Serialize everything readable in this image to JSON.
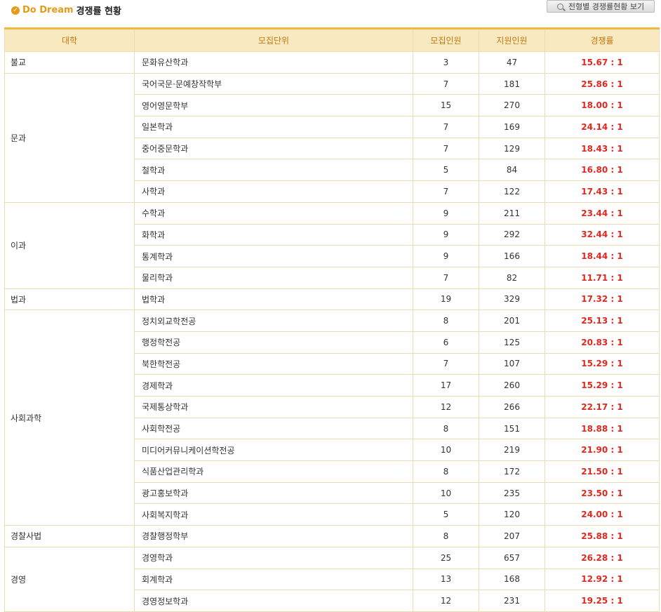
{
  "header": {
    "brand": "Do Dream",
    "title": "경쟁률 현황",
    "view_button": "전형별 경쟁률현황 보기"
  },
  "columns": [
    "대학",
    "모집단위",
    "모집인원",
    "지원인원",
    "경쟁률"
  ],
  "colors": {
    "accent": "#e69a17",
    "header_bg": "#f9e9c0",
    "rate": "#e0281e"
  },
  "groups": [
    {
      "college": "불교",
      "rows": [
        {
          "unit": "문화유산학과",
          "quota": "3",
          "applicants": "47",
          "rate": "15.67 : 1"
        }
      ]
    },
    {
      "college": "문과",
      "rows": [
        {
          "unit": "국어국문·문예창작학부",
          "quota": "7",
          "applicants": "181",
          "rate": "25.86 : 1"
        },
        {
          "unit": "영어영문학부",
          "quota": "15",
          "applicants": "270",
          "rate": "18.00 : 1"
        },
        {
          "unit": "일본학과",
          "quota": "7",
          "applicants": "169",
          "rate": "24.14 : 1"
        },
        {
          "unit": "중어중문학과",
          "quota": "7",
          "applicants": "129",
          "rate": "18.43 : 1"
        },
        {
          "unit": "철학과",
          "quota": "5",
          "applicants": "84",
          "rate": "16.80 : 1"
        },
        {
          "unit": "사학과",
          "quota": "7",
          "applicants": "122",
          "rate": "17.43 : 1"
        }
      ]
    },
    {
      "college": "이과",
      "rows": [
        {
          "unit": "수학과",
          "quota": "9",
          "applicants": "211",
          "rate": "23.44 : 1"
        },
        {
          "unit": "화학과",
          "quota": "9",
          "applicants": "292",
          "rate": "32.44 : 1"
        },
        {
          "unit": "통계학과",
          "quota": "9",
          "applicants": "166",
          "rate": "18.44 : 1"
        },
        {
          "unit": "물리학과",
          "quota": "7",
          "applicants": "82",
          "rate": "11.71 : 1"
        }
      ]
    },
    {
      "college": "법과",
      "rows": [
        {
          "unit": "법학과",
          "quota": "19",
          "applicants": "329",
          "rate": "17.32 : 1"
        }
      ]
    },
    {
      "college": "사회과학",
      "rows": [
        {
          "unit": "정치외교학전공",
          "quota": "8",
          "applicants": "201",
          "rate": "25.13 : 1"
        },
        {
          "unit": "행정학전공",
          "quota": "6",
          "applicants": "125",
          "rate": "20.83 : 1"
        },
        {
          "unit": "북한학전공",
          "quota": "7",
          "applicants": "107",
          "rate": "15.29 : 1"
        },
        {
          "unit": "경제학과",
          "quota": "17",
          "applicants": "260",
          "rate": "15.29 : 1"
        },
        {
          "unit": "국제통상학과",
          "quota": "12",
          "applicants": "266",
          "rate": "22.17 : 1"
        },
        {
          "unit": "사회학전공",
          "quota": "8",
          "applicants": "151",
          "rate": "18.88 : 1"
        },
        {
          "unit": "미디어커뮤니케이션학전공",
          "quota": "10",
          "applicants": "219",
          "rate": "21.90 : 1"
        },
        {
          "unit": "식품산업관리학과",
          "quota": "8",
          "applicants": "172",
          "rate": "21.50 : 1"
        },
        {
          "unit": "광고홍보학과",
          "quota": "10",
          "applicants": "235",
          "rate": "23.50 : 1"
        },
        {
          "unit": "사회복지학과",
          "quota": "5",
          "applicants": "120",
          "rate": "24.00 : 1"
        }
      ]
    },
    {
      "college": "경찰사법",
      "rows": [
        {
          "unit": "경찰행정학부",
          "quota": "8",
          "applicants": "207",
          "rate": "25.88 : 1"
        }
      ]
    },
    {
      "college": "경영",
      "rows": [
        {
          "unit": "경영학과",
          "quota": "25",
          "applicants": "657",
          "rate": "26.28 : 1"
        },
        {
          "unit": "회계학과",
          "quota": "13",
          "applicants": "168",
          "rate": "12.92 : 1"
        },
        {
          "unit": "경영정보학과",
          "quota": "12",
          "applicants": "231",
          "rate": "19.25 : 1"
        }
      ]
    }
  ]
}
